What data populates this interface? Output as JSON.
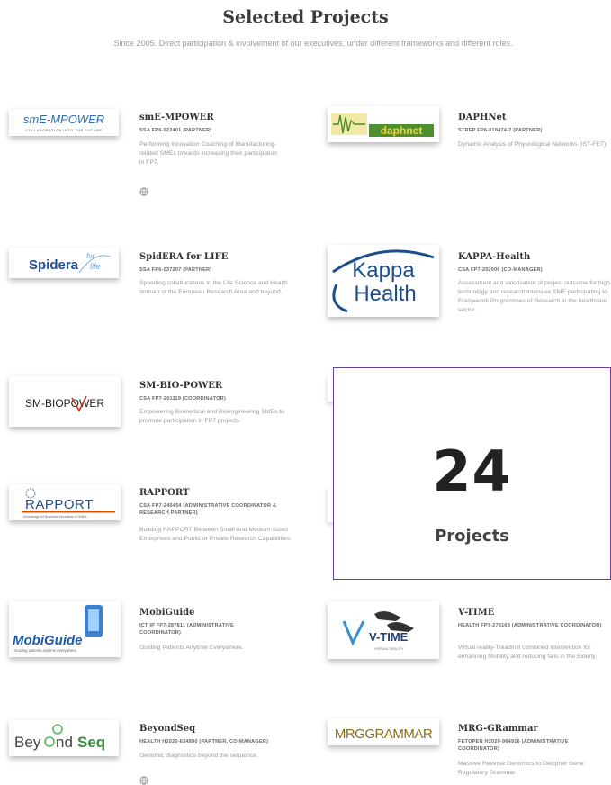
{
  "header": {
    "title": "Selected Projects",
    "subtitle": "Since 2005. Direct participation & involvement of our executives, under different frameworks and different roles."
  },
  "projects": [
    {
      "name": "smE-MPOWER",
      "code": "SSA FP6-022401 (PARTNER)",
      "description": "Performing Innovation Coaching of Manufacturing-related SMEs towards increasing their participation in FP7.",
      "logo_text": "smE-MPOWER",
      "logo_tagline": "COLLABORATION INTO THE FUTURE"
    },
    {
      "name": "DAPHNet",
      "code": "STREP FP6-018474-2 (PARTNER)",
      "description": "Dynamic Analysis of Physiological Networks (IST-FET).",
      "logo_text": "daphnet"
    },
    {
      "name": "SpidERA for LIFE",
      "code": "SSA FP6-037207 (PARTNER)",
      "description": "Speeding collaborations in the Life Science and Health domain of the European Research Area and beyond.",
      "logo_text": "Spidera",
      "logo_for": "for",
      "logo_life": "life"
    },
    {
      "name": "KAPPA-Health",
      "code": "CSA FP7-202006 (CO-MANAGER)",
      "description": "Assessment and valorisation of project outcome for high technology and research intensive SME participating to Framework Programmes of Research in the healthcare sector.",
      "logo_line1": "Kappa",
      "logo_line2": "Health"
    },
    {
      "name": "SM-BIO-POWER",
      "code": "CSA FP7-201119 (COORDINATOR)",
      "description": "Empowering Biomedical and Bioengineering SMEs to promote participation in FP7 projects.",
      "logo_text": "SM-BIOPOWER"
    },
    {
      "name": "RAPPORT",
      "code": "CSA FP7-245454 (ADMINISTRATIVE COORDINATOR & RESEARCH PARTNER)",
      "description": "Building RAPPORT Between Small And Medium-Sized Enterprises and Public or Private Research Capabilities.",
      "logo_text": "RAPPORT",
      "logo_tagline": "Knowledge for Business Innovation in SMEs"
    },
    {
      "name": "MobiGuide",
      "code": "ICT IP FP7-287811 (ADMINISTRATIVE COORDINATOR)",
      "description": "Guiding Patients Anytime Everywhere.",
      "logo_text": "MobiGuide",
      "logo_tagline": "Guiding patients anytime everywhere"
    },
    {
      "name": "V-TIME",
      "code": "HEALTH FP7-278169 (ADMINISTRATIVE COORDINATOR)",
      "description": "Virtual reality-Treadmill combined intervention for enhancing Mobility and reducing falls in the Elderly.",
      "logo_text": "V-TIME",
      "logo_tagline": "VIRTUAL REALITY"
    },
    {
      "name": "BeyondSeq",
      "code": "HEALTH H2020-634890 (PARTNER, CO-MANAGER)",
      "description": "Genomic diagnostics beyond the sequence.",
      "logo_text1": "Bey",
      "logo_text2": "nd",
      "logo_text3": "Seq"
    },
    {
      "name": "MRG-GRammar",
      "code": "FETOPEN H2020-964916 (ADMINISTRATIVE COORDINATOR)",
      "description": "Massive Reverse Genomics to Decipher Gene Regulatory Grammar",
      "logo_text": "MRGGRAMMAR"
    }
  ],
  "stat": {
    "number": "24",
    "label": "Projects"
  },
  "colors": {
    "accent_border": "#6b3fa0",
    "title": "#3b3b3b",
    "muted_text": "#9a9a9a"
  },
  "icons": [
    "globe-icon",
    "globe-icon",
    "globe-icon"
  ]
}
